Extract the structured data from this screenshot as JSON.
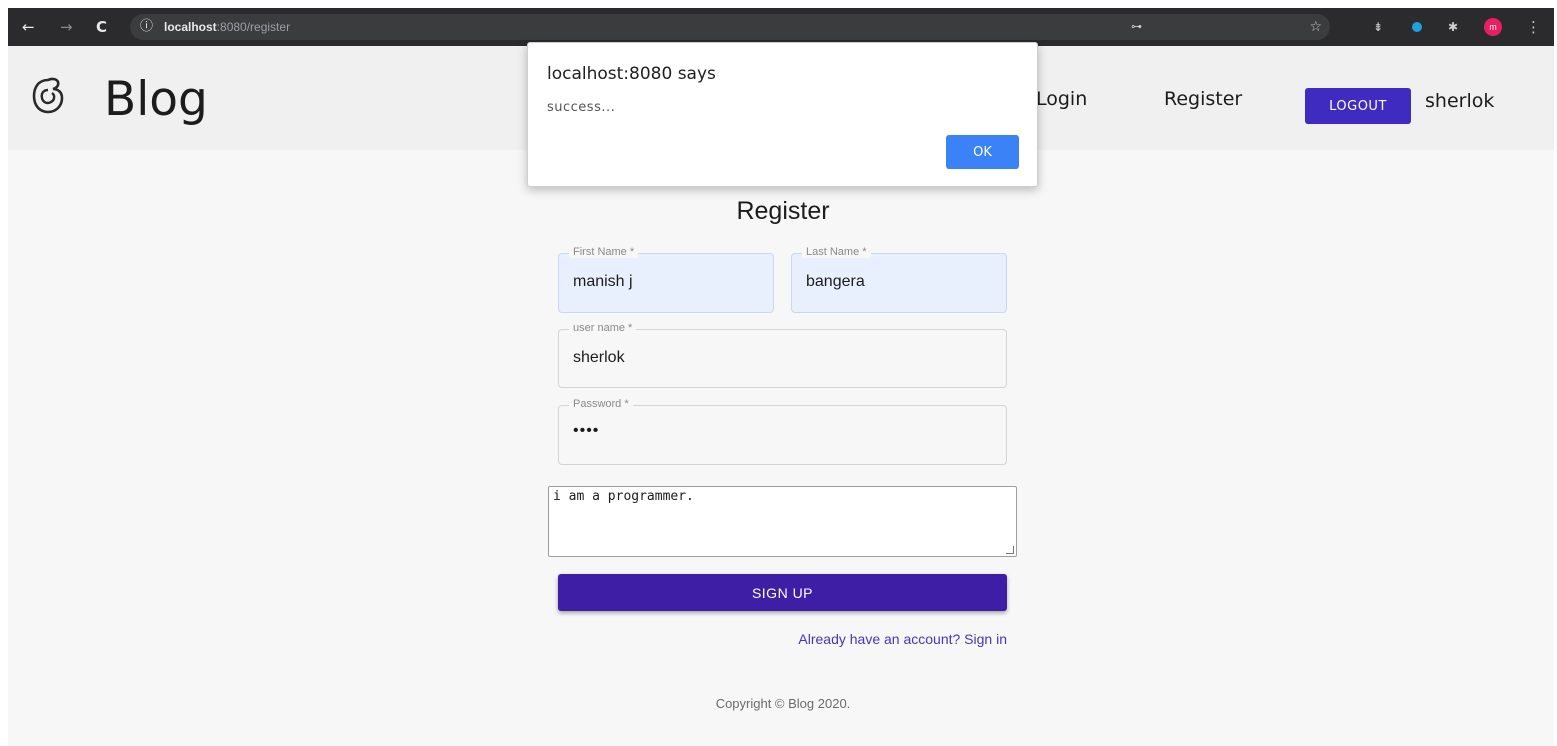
{
  "browser": {
    "back_icon": "←",
    "forward_icon": "→",
    "reload_icon": "C",
    "info_icon": "ⓘ",
    "url_host": "localhost",
    "url_rest": ":8080/register",
    "key_icon": "⊶",
    "star_icon": "☆",
    "ext1_icon": "⇟",
    "ext3_icon": "✱",
    "profile_initial": "m",
    "menu_icon": "⋮"
  },
  "header": {
    "logo_icon": "blog-logo-icon",
    "brand": "Blog",
    "nav": {
      "login": "Login",
      "register": "Register"
    },
    "logout_label": "LOGOUT",
    "username": "sherlok",
    "accent_color": "#3f2bc0"
  },
  "form": {
    "title": "Register",
    "first_name": {
      "label": "First Name *",
      "value": "manish j"
    },
    "last_name": {
      "label": "Last Name *",
      "value": "bangera"
    },
    "user_name": {
      "label": "user name *",
      "value": "sherlok"
    },
    "password": {
      "label": "Password *",
      "value": "••••"
    },
    "bio": "i am a programmer.",
    "submit_label": "SIGN UP",
    "signin_link": "Already have an account? Sign in"
  },
  "footer": {
    "copyright": "Copyright © Blog 2020."
  },
  "alert": {
    "title": "localhost:8080 says",
    "message": "success...",
    "ok_label": "OK"
  }
}
